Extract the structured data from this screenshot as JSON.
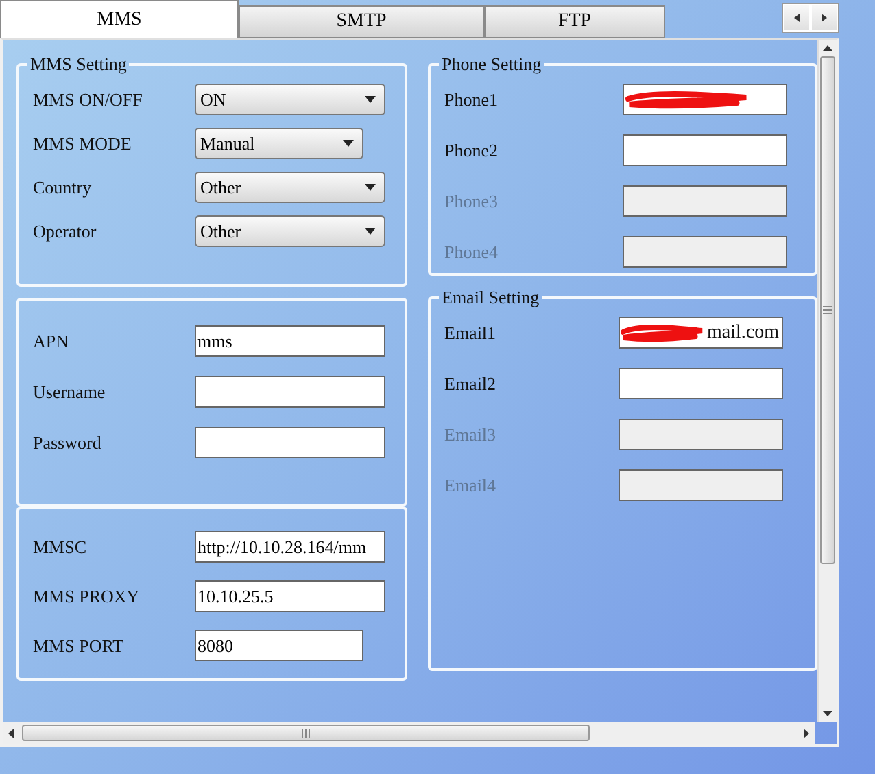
{
  "tabs": [
    {
      "label": "MMS",
      "selected": true
    },
    {
      "label": "SMTP",
      "selected": false
    },
    {
      "label": "FTP",
      "selected": false
    }
  ],
  "left_groups": [
    {
      "title": "MMS Setting",
      "fields": [
        {
          "label": "MMS ON/OFF",
          "kind": "dropdown",
          "value": "ON"
        },
        {
          "label": "MMS MODE",
          "kind": "dropdown",
          "value": "Manual"
        },
        {
          "label": "Country",
          "kind": "dropdown",
          "value": "Other"
        },
        {
          "label": "Operator",
          "kind": "dropdown",
          "value": "Other"
        }
      ]
    },
    {
      "fields": [
        {
          "label": "APN",
          "kind": "text",
          "value": "mms"
        },
        {
          "label": "Username",
          "kind": "text"
        },
        {
          "label": "Password",
          "kind": "text"
        }
      ]
    },
    {
      "fields": [
        {
          "label": "MMSC",
          "kind": "text",
          "value": "http://10.10.28.164/mm"
        },
        {
          "label": "MMS PROXY",
          "kind": "text",
          "value": "10.10.25.5"
        },
        {
          "label": "MMS PORT",
          "kind": "text",
          "value": "8080"
        }
      ]
    }
  ],
  "right_groups": [
    {
      "title": "Phone Setting",
      "fields": [
        {
          "label": "Phone1",
          "disabled": false,
          "redacted": true
        },
        {
          "label": "Phone2",
          "disabled": false,
          "redacted": false
        },
        {
          "label": "Phone3",
          "disabled": true,
          "redacted": false
        },
        {
          "label": "Phone4",
          "disabled": true,
          "redacted": false
        }
      ]
    },
    {
      "title": "Email Setting",
      "fields": [
        {
          "label": "Email1",
          "value": "mail.com",
          "disabled": false,
          "redacted": true
        },
        {
          "label": "Email2",
          "disabled": false,
          "redacted": false
        },
        {
          "label": "Email3",
          "disabled": true,
          "redacted": false
        },
        {
          "label": "Email4",
          "disabled": true,
          "redacted": false
        }
      ]
    }
  ]
}
